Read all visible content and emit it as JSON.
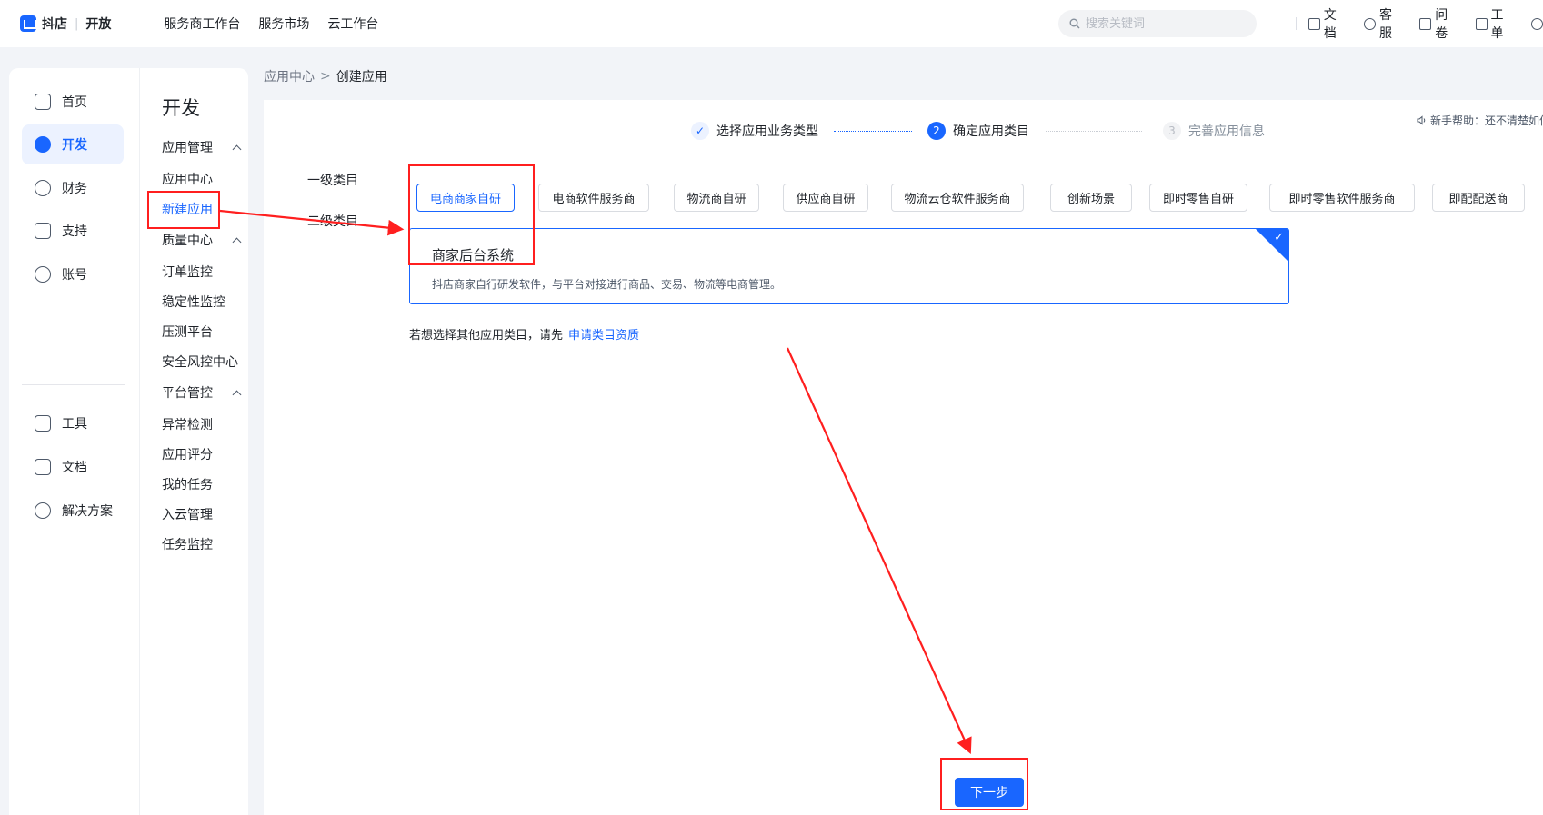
{
  "header": {
    "logo_brand": "抖店",
    "logo_divider": "|",
    "logo_suffix": "开放",
    "nav": [
      "服务商工作台",
      "服务市场",
      "云工作台"
    ],
    "search_placeholder": "搜索关键词",
    "links": [
      {
        "label": "文档",
        "icon": "document-icon"
      },
      {
        "label": "客服",
        "icon": "smile-icon"
      },
      {
        "label": "问卷",
        "icon": "megaphone-icon"
      },
      {
        "label": "工单",
        "icon": "ticket-icon"
      }
    ]
  },
  "sidebar": {
    "items": [
      {
        "label": "首页",
        "icon": "home-icon"
      },
      {
        "label": "开发",
        "icon": "cube-icon",
        "active": true
      },
      {
        "label": "财务",
        "icon": "yen-shield-icon"
      },
      {
        "label": "支持",
        "icon": "info-icon"
      },
      {
        "label": "账号",
        "icon": "user-icon"
      },
      {
        "label": "工具",
        "icon": "toolbox-icon"
      },
      {
        "label": "文档",
        "icon": "document-icon"
      },
      {
        "label": "解决方案",
        "icon": "bulb-icon"
      }
    ]
  },
  "submenu": {
    "title": "开发",
    "groups": [
      {
        "label": "应用管理",
        "items": [
          "应用中心",
          "新建应用"
        ]
      },
      {
        "label": "质量中心",
        "items": [
          "订单监控",
          "稳定性监控",
          "压测平台",
          "安全风控中心"
        ]
      },
      {
        "label": "平台管控",
        "items": [
          "异常检测",
          "应用评分",
          "我的任务",
          "入云管理",
          "任务监控"
        ]
      }
    ],
    "active_item": "新建应用"
  },
  "breadcrumb": {
    "parent": "应用中心",
    "separator": ">",
    "current": "创建应用"
  },
  "steps": [
    {
      "index": "✓",
      "label": "选择应用业务类型",
      "state": "done"
    },
    {
      "index": "2",
      "label": "确定应用类目",
      "state": "active"
    },
    {
      "index": "3",
      "label": "完善应用信息",
      "state": "todo"
    }
  ],
  "help_tip": "新手帮助：还不清楚如何",
  "form": {
    "level1_label": "一级类目",
    "level2_label": "二级类目",
    "level1_options": [
      "电商商家自研",
      "电商软件服务商",
      "物流商自研",
      "供应商自研",
      "物流云仓软件服务商",
      "创新场景",
      "即时零售自研",
      "即时零售软件服务商",
      "即配配送商"
    ],
    "level1_selected": "电商商家自研",
    "level2_card": {
      "title": "商家后台系统",
      "description": "抖店商家自行研发软件，与平台对接进行商品、交易、物流等电商管理。",
      "check": "✓"
    },
    "hint_text": "若想选择其他应用类目，请先",
    "hint_link": "申请类目资质",
    "next_button": "下一步"
  },
  "colors": {
    "accent": "#1966ff",
    "annotation": "#ff1f1f"
  }
}
